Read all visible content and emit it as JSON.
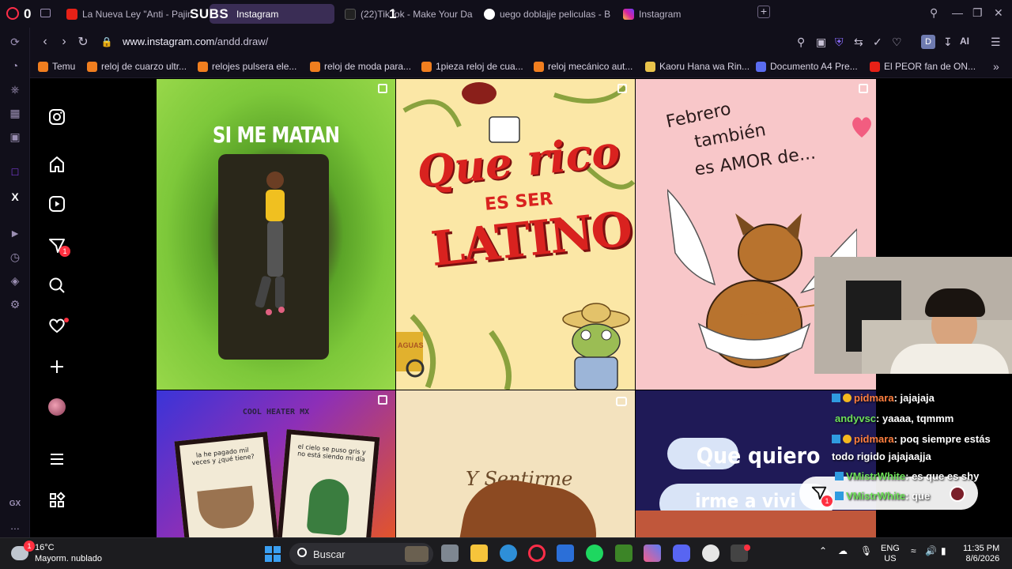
{
  "browser": {
    "overlay_subs": "SUBS",
    "overlay_one": "1",
    "overlay_zero": "0",
    "tabs": [
      {
        "label": "La Nueva Ley \"Anti - Pajin",
        "favicon_color": "#e62117"
      },
      {
        "label": "Instagram",
        "favicon_color": "#d6249f"
      },
      {
        "label": "(22)TikTok - Make Your Da",
        "favicon_color": "#222222"
      },
      {
        "label": "uego doblajje peliculas - B",
        "favicon_color": "#4285f4"
      },
      {
        "label": "Instagram",
        "favicon_color": "#d6249f"
      }
    ],
    "url_host": "www.instagram.com",
    "url_path": "/andd.draw/",
    "profile_initial": "D",
    "ai_label": "AI",
    "bookmarks": [
      "Temu",
      "reloj de cuarzo ultr...",
      "relojes pulsera ele...",
      "reloj de moda para...",
      "1pieza reloj de cua...",
      "reloj mecánico aut...",
      "Kaoru Hana wa Rin...",
      "Documento A4 Pre...",
      "El PEOR fan de ON..."
    ],
    "sidebar_gx": "GX",
    "sidebar_more": "..."
  },
  "instagram": {
    "messages_badge": "1"
  },
  "posts": {
    "p1_title": "SI ME MATAN",
    "p2_line1": "Que rico",
    "p2_line2": "ES SER",
    "p2_line3": "LATINO",
    "p2_sign": "AGUAS",
    "p3_line1": "Febrero",
    "p3_line2": "también",
    "p3_line3": "es AMOR de...",
    "p4_brand": "COOL HEATER MX",
    "p4_card1": "la he pagado mil veces y ¿qué tiene?",
    "p4_card2": "el cielo se puso gris y no está siendo mi día",
    "p5_text": "Y Sentirme",
    "p6_line1": "Que quiero",
    "p6_line2": "irme a vivi"
  },
  "chat": {
    "messages": [
      {
        "user": "pidmara",
        "text": ": jajajaja",
        "user_color": "#ff7f3f",
        "badges": [
          "twitch",
          "gold"
        ]
      },
      {
        "user": "andyvsc",
        "text": ": yaaaa, tqmmm",
        "user_color": "#6ee05a",
        "badges": []
      },
      {
        "user": "pidmara",
        "text": ": poq siempre estás",
        "user_color": "#ff7f3f",
        "badges": [
          "twitch",
          "gold"
        ]
      },
      {
        "user": "",
        "text": "todo rigido jajajaajja",
        "user_color": "#ffffff",
        "badges": []
      },
      {
        "user": "VMistrWhite",
        "text": ": es que es shy",
        "user_color": "#6ee05a",
        "badges": [
          "twitch"
        ]
      },
      {
        "user": "VMistrWhite",
        "text": ": que",
        "user_color": "#6ee05a",
        "badges": [
          "twitch"
        ]
      }
    ]
  },
  "taskbar": {
    "temperature": "16°C",
    "weather": "Mayorm. nublado",
    "weather_badge": "1",
    "search_placeholder": "Buscar",
    "lang_line1": "ENG",
    "lang_line2": "US",
    "time": "11:35 PM",
    "date": "8/6/2026"
  }
}
